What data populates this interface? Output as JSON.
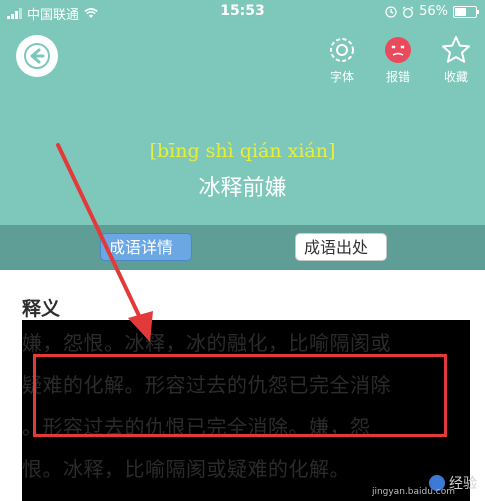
{
  "status_bar": {
    "carrier": "中国联通",
    "time": "15:53",
    "battery_text": "56%"
  },
  "header": {
    "tools": [
      {
        "label": "字体",
        "icon": "font-settings-icon"
      },
      {
        "label": "报错",
        "icon": "report-error-icon"
      },
      {
        "label": "收藏",
        "icon": "star-icon"
      }
    ],
    "pinyin": "[bīng shì qián xián]",
    "idiom": "冰释前嫌"
  },
  "tabs": [
    {
      "label": "成语详情",
      "active": true
    },
    {
      "label": "成语出处",
      "active": false
    }
  ],
  "content": {
    "section_title": "释义",
    "definition_lines": [
      "嫌，怨恨。冰释，冰的融化，比喻隔阂或",
      "疑难的化解。形容过去的仇怨已完全消除",
      "。形容过去的仇恨已完全消除。嫌，怨",
      "恨。冰释，比喻隔阂或疑难的化解。"
    ]
  },
  "watermark": {
    "brand": "经验",
    "site": "jingyan.baidu.com"
  },
  "colors": {
    "header_bg": "#7ec8bb",
    "tabbar_bg": "#5e9e96",
    "pinyin": "#e8ef3a",
    "annotation": "#e23a3a"
  }
}
